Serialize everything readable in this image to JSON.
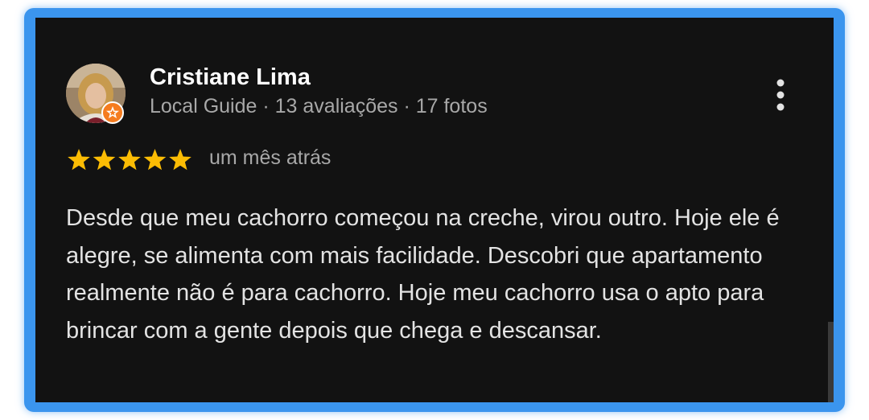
{
  "review": {
    "author_name": "Cristiane Lima",
    "author_meta": "Local Guide · 13 avaliações · 17 fotos",
    "rating": 5,
    "rating_max": 5,
    "time_ago": "um mês atrás",
    "text": "Desde que meu cachorro começou na creche, virou outro. Hoje ele é alegre, se alimenta com mais facilidade. Descobri que apartamento realmente não é para cachorro. Hoje meu cachorro usa o apto para brincar com a gente depois que chega e descansar.",
    "badge_icon": "local-guide-star-icon",
    "menu_icon": "more-vertical-icon"
  },
  "colors": {
    "frame": "#3b95ee",
    "card_bg": "#121212",
    "star": "#fbbc04",
    "badge": "#f57c1f",
    "secondary_text": "#a8a8a8"
  }
}
